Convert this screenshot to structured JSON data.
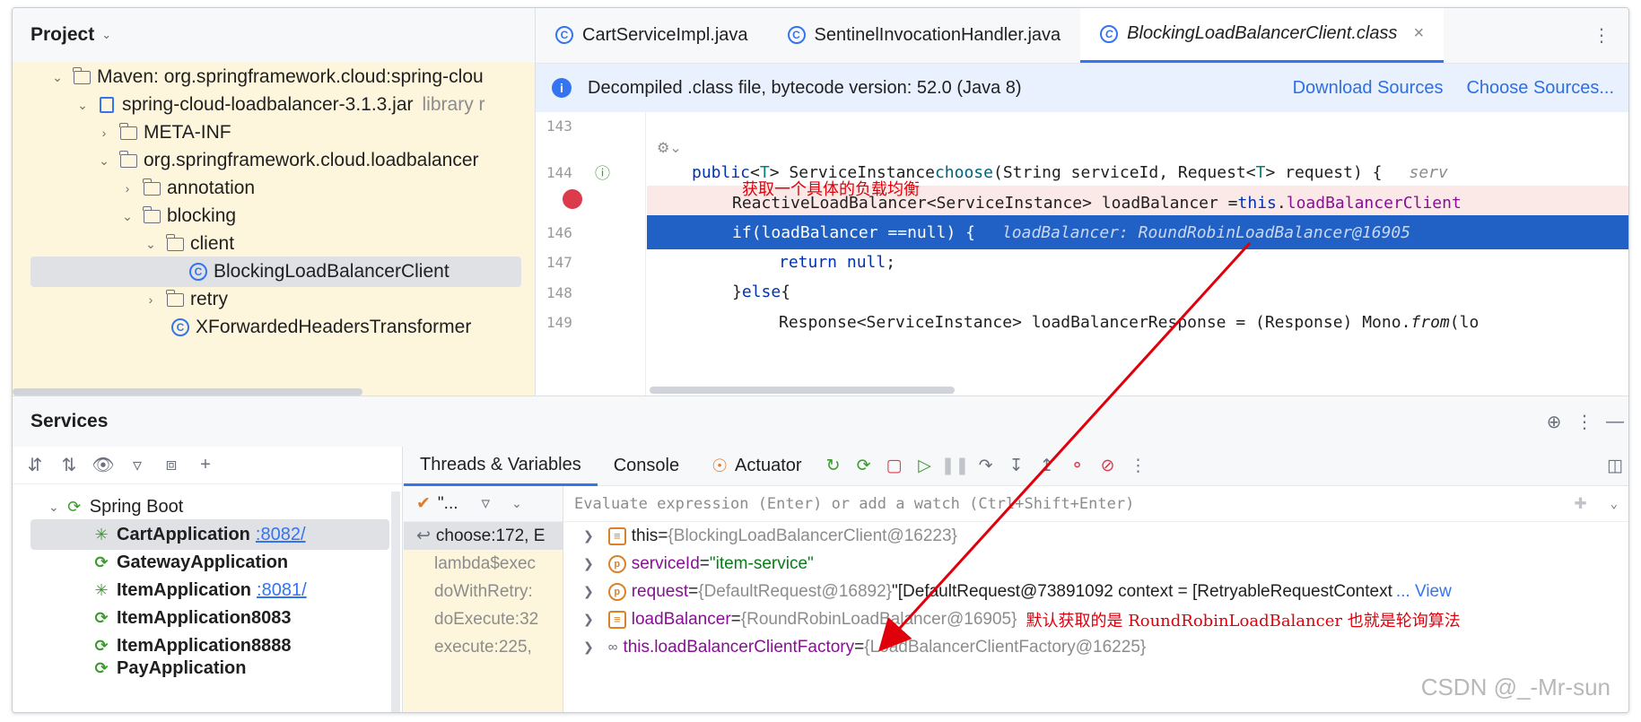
{
  "project": {
    "title": "Project",
    "tree": [
      {
        "label": "Maven: org.springframework.cloud:spring-clou",
        "muted": "",
        "icon": "maven-library-icon"
      },
      {
        "label": "spring-cloud-loadbalancer-3.1.3.jar",
        "muted": "library r",
        "icon": "jar-icon"
      },
      {
        "label": "META-INF",
        "icon": "folder-icon"
      },
      {
        "label": "org.springframework.cloud.loadbalancer",
        "icon": "folder-icon"
      },
      {
        "label": "annotation",
        "icon": "folder-icon"
      },
      {
        "label": "blocking",
        "icon": "folder-icon"
      },
      {
        "label": "client",
        "icon": "folder-icon"
      },
      {
        "label": "BlockingLoadBalancerClient",
        "icon": "class-icon"
      },
      {
        "label": "retry",
        "icon": "folder-icon"
      },
      {
        "label": "XForwardedHeadersTransformer",
        "icon": "class-icon"
      }
    ]
  },
  "editor": {
    "tabs": [
      {
        "label": "CartServiceImpl.java"
      },
      {
        "label": "SentinelInvocationHandler.java"
      },
      {
        "label": "BlockingLoadBalancerClient.class"
      }
    ],
    "banner": {
      "text": "Decompiled .class file, bytecode version: 52.0 (Java 8)",
      "download": "Download Sources",
      "choose": "Choose Sources..."
    },
    "line_numbers": [
      "143",
      "144",
      "146",
      "147",
      "148",
      "149"
    ],
    "annotation_cn": "获取一个具体的负载均衡",
    "code": {
      "l144_a": "public",
      "l144_b": " <",
      "l144_c": "T",
      "l144_d": "> ServiceInstance ",
      "l144_e": "choose",
      "l144_f": "(String serviceId, Request<",
      "l144_g": "T",
      "l144_h": "> request) {",
      "l144_hint": "serv",
      "l145_a": "ReactiveLoadBalancer<ServiceInstance> loadBalancer = ",
      "l145_b": "this",
      "l145_c": ".",
      "l145_d": "loadBalancerClient",
      "l146_a": "if",
      "l146_b": " (loadBalancer == ",
      "l146_c": "null",
      "l146_d": ") {",
      "l146_hint": "loadBalancer: RoundRobinLoadBalancer@16905",
      "l147_a": "return",
      "l147_b": "null",
      "l147_c": ";",
      "l148_a": "} ",
      "l148_b": "else",
      "l148_c": " {",
      "l149_a": "Response<ServiceInstance> loadBalancerResponse = (Response) Mono.",
      "l149_b": "from",
      "l149_c": "(lo"
    }
  },
  "services": {
    "title": "Services",
    "tree": [
      {
        "label": "Spring Boot",
        "port": ""
      },
      {
        "label": "CartApplication",
        "port": ":8082/"
      },
      {
        "label": "GatewayApplication",
        "port": ""
      },
      {
        "label": "ItemApplication",
        "port": ":8081/"
      },
      {
        "label": "ItemApplication8083",
        "port": ""
      },
      {
        "label": "ItemApplication8888",
        "port": ""
      },
      {
        "label": "PayApplication",
        "port": ""
      }
    ],
    "debugger": {
      "tabs": [
        "Threads & Variables",
        "Console",
        "Actuator"
      ],
      "thread_label": "\"...",
      "frames": [
        "choose:172, E",
        "lambda$exec",
        "doWithRetry:",
        "doExecute:32",
        "execute:225,"
      ],
      "eval_placeholder": "Evaluate expression (Enter) or add a watch (Ctrl+Shift+Enter)",
      "variables": [
        {
          "name": "this",
          "eq": " = ",
          "value": "{BlockingLoadBalancerClient@16223}"
        },
        {
          "name": "serviceId",
          "eq": " = ",
          "value": "\"item-service\""
        },
        {
          "name": "request",
          "eq": " = ",
          "value": "{DefaultRequest@16892}",
          "extra": " \"[DefaultRequest@73891092 context = [RetryableRequestContext",
          "link": "... View"
        },
        {
          "name": "loadBalancer",
          "eq": " = ",
          "value": "{RoundRobinLoadBalancer@16905}",
          "note_cn": "默认获取的是 RoundRobinLoadBalancer 也就是轮询算法"
        },
        {
          "name": "this.loadBalancerClientFactory",
          "eq": " = ",
          "value": "{LoadBalancerClientFactory@16225}"
        }
      ]
    }
  },
  "watermark": "CSDN @_-Mr-sun",
  "colors": {
    "accent": "#3574f0",
    "highlight": "#2160c4",
    "annotation": "#e0000b"
  }
}
